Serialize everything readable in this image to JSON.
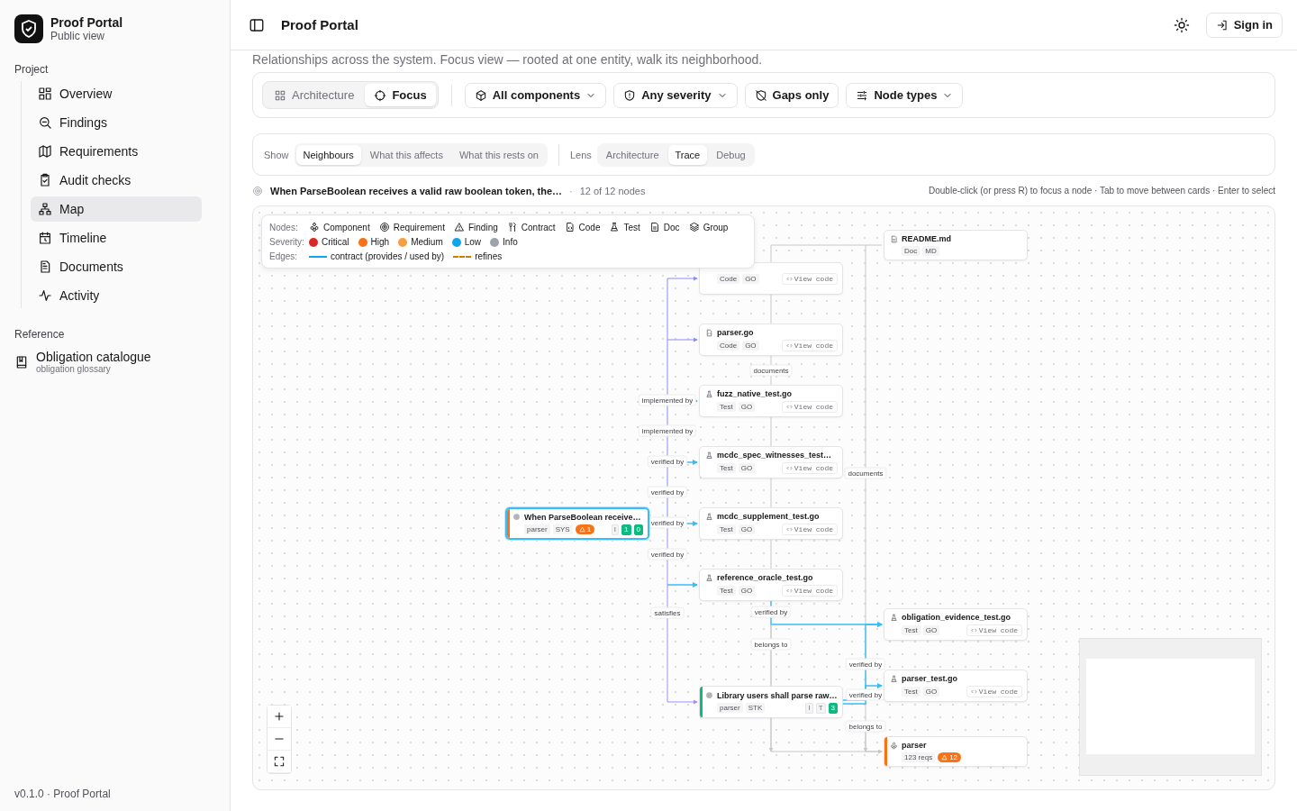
{
  "sidebar": {
    "brand": {
      "title": "Proof Portal",
      "subtitle": "Public view"
    },
    "sections": [
      {
        "label": "Project",
        "items": [
          {
            "label": "Overview",
            "selected": false
          },
          {
            "label": "Findings",
            "selected": false
          },
          {
            "label": "Requirements",
            "selected": false
          },
          {
            "label": "Audit checks",
            "selected": false
          },
          {
            "label": "Map",
            "selected": true
          },
          {
            "label": "Timeline",
            "selected": false
          },
          {
            "label": "Documents",
            "selected": false
          },
          {
            "label": "Activity",
            "selected": false
          }
        ]
      },
      {
        "label": "Reference",
        "items": [
          {
            "label": "Obligation catalogue",
            "subtitle": "obligation glossary",
            "selected": false
          }
        ]
      }
    ],
    "footer": "v0.1.0 · Proof Portal"
  },
  "header": {
    "title": "Proof Portal",
    "sign_in": "Sign in"
  },
  "intro": "Relationships across the system. Focus view — rooted at one entity, walk its neighborhood.",
  "toolbar": {
    "view_modes": [
      {
        "label": "Architecture",
        "selected": false
      },
      {
        "label": "Focus",
        "selected": true
      }
    ],
    "filters": [
      {
        "label": "All components",
        "kind": "dropdown"
      },
      {
        "label": "Any severity",
        "kind": "dropdown"
      },
      {
        "label": "Gaps only",
        "kind": "toggle"
      },
      {
        "label": "Node types",
        "kind": "dropdown"
      }
    ]
  },
  "controls": {
    "show": {
      "label": "Show",
      "options": [
        {
          "label": "Neighbours",
          "selected": true
        },
        {
          "label": "What this affects",
          "selected": false
        },
        {
          "label": "What this rests on",
          "selected": false
        }
      ]
    },
    "lens": {
      "label": "Lens",
      "options": [
        {
          "label": "Architecture",
          "selected": false
        },
        {
          "label": "Trace",
          "selected": true
        },
        {
          "label": "Debug",
          "selected": false
        }
      ]
    }
  },
  "focus": {
    "title": "When ParseBoolean receives a valid raw boolean token, the…",
    "separator": "·",
    "count": "12 of 12 nodes",
    "hint": "Double-click (or press R) to focus a node · Tab to move between cards · Enter to select"
  },
  "map": {
    "legend": {
      "nodes_label": "Nodes:",
      "node_types": [
        "Component",
        "Requirement",
        "Finding",
        "Contract",
        "Code",
        "Test",
        "Doc",
        "Group"
      ],
      "severity_label": "Severity:",
      "severities": [
        {
          "label": "Critical",
          "color": "#dc2626"
        },
        {
          "label": "High",
          "color": "#f97316"
        },
        {
          "label": "Medium",
          "color": "#f59e42"
        },
        {
          "label": "Low",
          "color": "#0ea5e9"
        },
        {
          "label": "Info",
          "color": "#9ca3af"
        }
      ],
      "edges_label": "Edges:",
      "edge_types": [
        {
          "label": "contract (provides / used by)",
          "kind": "solid",
          "color": "#0ea5e9"
        },
        {
          "label": "refines",
          "kind": "dashed",
          "color": "#d97706"
        }
      ]
    },
    "nodes": [
      {
        "kind": "doc",
        "title": "README.md",
        "tags": [
          "Doc",
          "MD"
        ],
        "selected": false
      },
      {
        "tags": [
          "Code",
          "GO"
        ],
        "action": "View code",
        "selected": false
      },
      {
        "kind": "code",
        "title": "parser.go",
        "tags": [
          "Code",
          "GO"
        ],
        "action": "View code",
        "selected": false
      },
      {
        "kind": "test",
        "title": "fuzz_native_test.go",
        "tags": [
          "Test",
          "GO"
        ],
        "action": "View code",
        "selected": false
      },
      {
        "kind": "test",
        "title": "mcdc_spec_witnesses_test…",
        "tags": [
          "Test",
          "GO"
        ],
        "action": "View code",
        "selected": false
      },
      {
        "kind": "requirement",
        "title": "When ParseBoolean receive…",
        "tags": [
          "parser",
          "SYS"
        ],
        "badge": "1",
        "chips": [
          {
            "text": "I",
            "kind": "muted"
          },
          {
            "text": "1",
            "kind": "ok"
          },
          {
            "text": "0",
            "kind": "ok"
          }
        ],
        "color": "#f97316",
        "selected": true
      },
      {
        "kind": "test",
        "title": "mcdc_supplement_test.go",
        "tags": [
          "Test",
          "GO"
        ],
        "action": "View code",
        "selected": false
      },
      {
        "kind": "test",
        "title": "reference_oracle_test.go",
        "tags": [
          "Test",
          "GO"
        ],
        "action": "View code",
        "selected": false
      },
      {
        "kind": "test",
        "title": "obligation_evidence_test.go",
        "tags": [
          "Test",
          "GO"
        ],
        "action": "View code",
        "selected": false
      },
      {
        "kind": "test",
        "title": "parser_test.go",
        "tags": [
          "Test",
          "GO"
        ],
        "action": "View code",
        "selected": false
      },
      {
        "kind": "requirement",
        "title": "Library users shall parse raw…",
        "tags": [
          "parser",
          "STK"
        ],
        "chips": [
          {
            "text": "I",
            "kind": "muted"
          },
          {
            "text": "T",
            "kind": "muted"
          },
          {
            "text": "3",
            "kind": "ok"
          }
        ],
        "color": "#10b981",
        "selected": false
      },
      {
        "kind": "component",
        "title": "parser",
        "tags": [
          "123 reqs"
        ],
        "badge": "12",
        "color": "#f97316",
        "selected": false
      }
    ],
    "edges": [
      {
        "label": "documents",
        "kind": "documents"
      },
      {
        "label": "implemented by",
        "kind": "implemented"
      },
      {
        "label": "implemented by",
        "kind": "implemented"
      },
      {
        "label": "verified by",
        "kind": "verified"
      },
      {
        "label": "documents",
        "kind": "documents"
      },
      {
        "label": "verified by",
        "kind": "verified"
      },
      {
        "label": "verified by",
        "kind": "verified"
      },
      {
        "label": "verified by",
        "kind": "verified"
      },
      {
        "label": "satisfies",
        "kind": "satisfies"
      },
      {
        "label": "verified by",
        "kind": "verified"
      },
      {
        "label": "belongs to",
        "kind": "belongs"
      },
      {
        "label": "verified by",
        "kind": "verified"
      },
      {
        "label": "verified by",
        "kind": "verified"
      },
      {
        "label": "belongs to",
        "kind": "belongs"
      }
    ]
  }
}
